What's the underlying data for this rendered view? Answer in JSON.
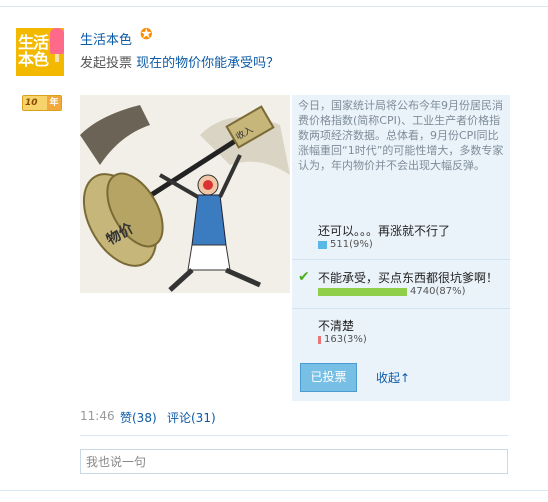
{
  "user": {
    "name": "生活本色",
    "avatar_text": "生活本色",
    "badge_year": "10",
    "badge_char": "年"
  },
  "post": {
    "action_text": "发起投票",
    "poll_title": "现在的物价你能承受吗？",
    "image": {
      "labels": [
        "物价",
        "收入"
      ]
    },
    "description": "今日，国家统计局将公布今年9月份居民消费价格指数(简称CPI)、工业生产者价格指数两项经济数据。总体看，9月份CPI同比涨幅重回“1时代”的可能性增大，多数专家认为，年内物价并不会出现大幅反弹。",
    "options": [
      {
        "label": "还可以。。。再涨就不行了",
        "count_text": "511(9%)",
        "votes": 511,
        "percent": 9,
        "color": "#59b8e6",
        "selected": false
      },
      {
        "label": "不能承受，买点东西都很坑爹啊！",
        "count_text": "4740(87%)",
        "votes": 4740,
        "percent": 87,
        "color": "#8fcf4a",
        "selected": true
      },
      {
        "label": "不清楚",
        "count_text": "163(3%)",
        "votes": 163,
        "percent": 3,
        "color": "#e77676",
        "selected": false
      }
    ],
    "vote_button": "已投票",
    "collapse_link": "收起↑",
    "time": "11:46",
    "likes": "赞(38)",
    "comments": "评论(31)",
    "comment_placeholder": "我也说一句"
  },
  "icons": {
    "star": "star-icon",
    "check": "check-icon",
    "avatar": "ice-pop-avatar"
  },
  "colors": {
    "link": "#0b5aa6",
    "panel": "#eaf3fa",
    "button": "#78bfe5"
  }
}
